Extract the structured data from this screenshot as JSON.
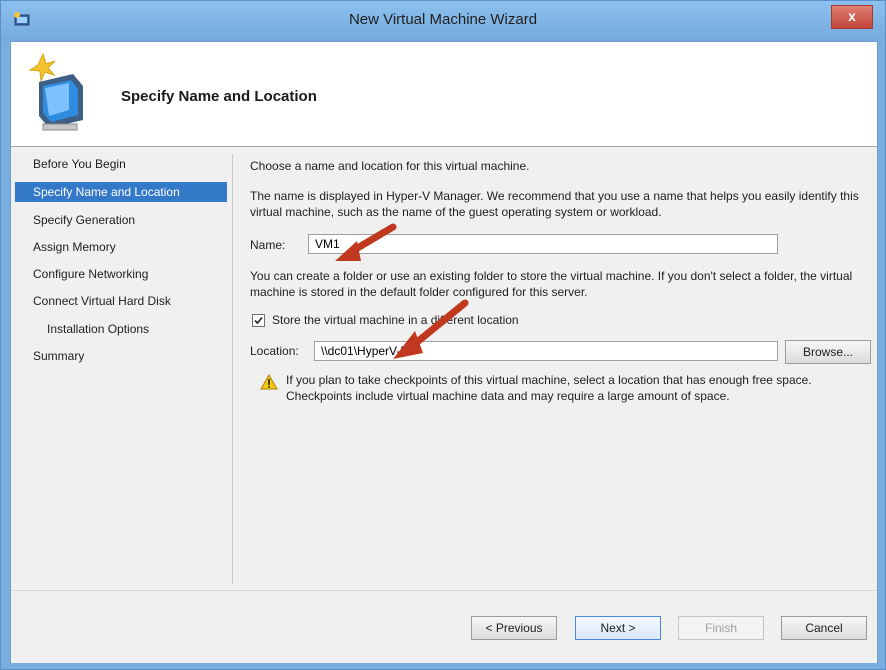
{
  "window": {
    "title": "New Virtual Machine Wizard",
    "close_label": "x"
  },
  "header": {
    "title": "Specify Name and Location"
  },
  "nav": {
    "items": [
      {
        "label": "Before You Begin",
        "selected": false,
        "sub": false
      },
      {
        "label": "Specify Name and Location",
        "selected": true,
        "sub": false
      },
      {
        "label": "Specify Generation",
        "selected": false,
        "sub": false
      },
      {
        "label": "Assign Memory",
        "selected": false,
        "sub": false
      },
      {
        "label": "Configure Networking",
        "selected": false,
        "sub": false
      },
      {
        "label": "Connect Virtual Hard Disk",
        "selected": false,
        "sub": false
      },
      {
        "label": "Installation Options",
        "selected": false,
        "sub": true
      },
      {
        "label": "Summary",
        "selected": false,
        "sub": false
      }
    ]
  },
  "content": {
    "intro": "Choose a name and location for this virtual machine.",
    "name_help": "The name is displayed in Hyper-V Manager. We recommend that you use a name that helps you easily identify this virtual machine, such as the name of the guest operating system or workload.",
    "name_label": "Name:",
    "name_value": "VM1",
    "folder_help": "You can create a folder or use an existing folder to store the virtual machine. If you don't select a folder, the virtual machine is stored in the default folder configured for this server.",
    "store_checkbox_label": "Store the virtual machine in a different location",
    "store_checked": true,
    "location_label": "Location:",
    "location_value": "\\\\dc01\\HyperV-FS",
    "browse_label": "Browse...",
    "warning_text": "If you plan to take checkpoints of this virtual machine, select a location that has enough free space. Checkpoints include virtual machine data and may require a large amount of space."
  },
  "footer": {
    "previous_label": "< Previous",
    "next_label": "Next >",
    "finish_label": "Finish",
    "cancel_label": "Cancel"
  },
  "colors": {
    "title_bar": "#7fb5e6",
    "selection": "#3478c8",
    "close_button": "#c9493d",
    "annotation_arrow": "#c0391f"
  }
}
